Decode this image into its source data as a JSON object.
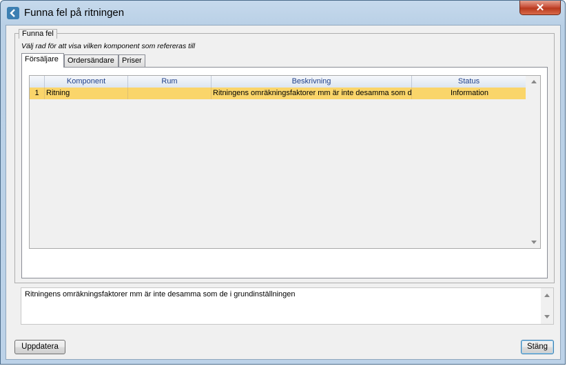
{
  "window": {
    "title": "Funna fel på ritningen"
  },
  "group": {
    "title": "Funna fel",
    "hint": "Välj rad för att visa vilken komponent som refereras till"
  },
  "tabs": [
    {
      "label": "Försäljare",
      "active": true
    },
    {
      "label": "Ordersändare",
      "active": false
    },
    {
      "label": "Priser",
      "active": false
    }
  ],
  "grid": {
    "columns": [
      "Komponent",
      "Rum",
      "Beskrivning",
      "Status"
    ],
    "rows": [
      {
        "index": "1",
        "komponent": "Ritning",
        "rum": "",
        "beskrivning": "Ritningens omräkningsfaktorer mm är inte desamma som de",
        "status": "Information"
      }
    ],
    "selected_row_color": "#fad56a",
    "header_text_color": "#1e3f8a"
  },
  "description": "Ritningens omräkningsfaktorer mm är inte desamma som de i grundinställningen",
  "buttons": {
    "update": "Uppdatera",
    "close": "Stäng"
  },
  "icons": {
    "app": "back-arrow-icon",
    "close": "close-x-icon"
  }
}
